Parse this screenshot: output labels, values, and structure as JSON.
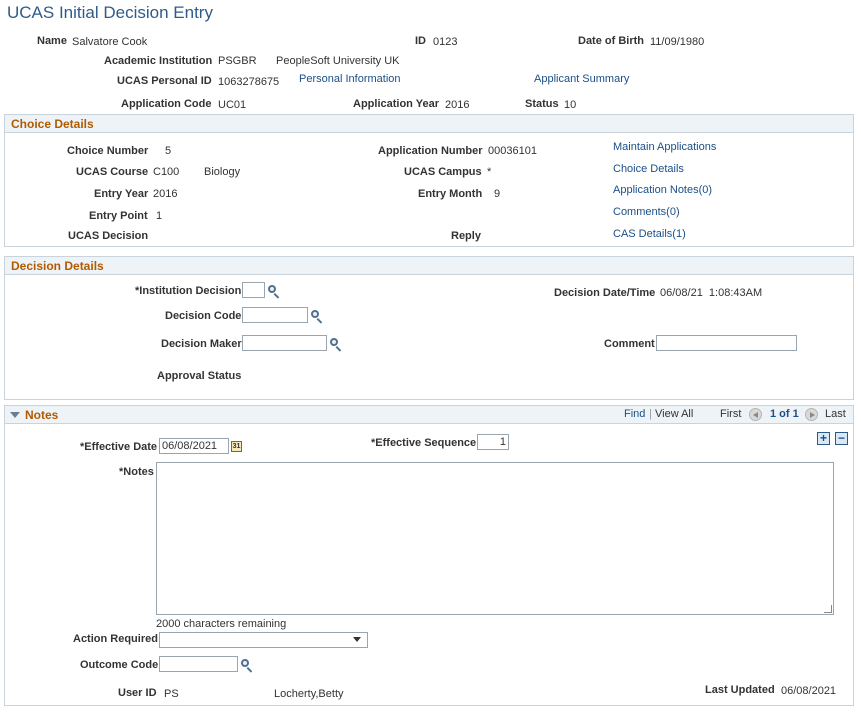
{
  "page": {
    "title": "UCAS Initial Decision Entry"
  },
  "header": {
    "name_label": "Name",
    "name_value": "Salvatore Cook",
    "id_label": "ID",
    "id_value": "0123",
    "dob_label": "Date of Birth",
    "dob_value": "11/09/1980",
    "institution_label": "Academic Institution",
    "institution_code": "PSGBR",
    "institution_name": "PeopleSoft University UK",
    "ucas_pid_label": "UCAS Personal ID",
    "ucas_pid_value": "1063278675",
    "personal_info_link": "Personal Information",
    "applicant_summary_link": "Applicant Summary",
    "app_code_label": "Application Code",
    "app_code_value": "UC01",
    "app_year_label": "Application Year",
    "app_year_value": "2016",
    "status_label": "Status",
    "status_value": "10"
  },
  "choice": {
    "section_title": "Choice Details",
    "choice_number_label": "Choice Number",
    "choice_number_value": "5",
    "app_number_label": "Application Number",
    "app_number_value": "00036101",
    "ucas_course_label": "UCAS Course",
    "ucas_course_code": "C100",
    "ucas_course_name": "Biology",
    "ucas_campus_label": "UCAS Campus",
    "ucas_campus_value": "*",
    "entry_year_label": "Entry Year",
    "entry_year_value": "2016",
    "entry_month_label": "Entry Month",
    "entry_month_value": "9",
    "entry_point_label": "Entry Point",
    "entry_point_value": "1",
    "ucas_decision_label": "UCAS Decision",
    "reply_label": "Reply",
    "links": {
      "maintain": "Maintain Applications",
      "choice_details": "Choice Details",
      "app_notes": "Application Notes(0)",
      "comments": "Comments(0)",
      "cas_details": "CAS Details(1)"
    }
  },
  "decision": {
    "section_title": "Decision Details",
    "institution_decision_label": "*Institution Decision",
    "institution_decision_value": "",
    "decision_datetime_label": "Decision Date/Time",
    "decision_datetime_value": "06/08/21  1:08:43AM",
    "decision_code_label": "Decision Code",
    "decision_code_value": "",
    "decision_maker_label": "Decision Maker",
    "decision_maker_value": "",
    "comment_label": "Comment",
    "comment_value": "",
    "approval_status_label": "Approval Status"
  },
  "notes": {
    "section_title": "Notes",
    "find_link": "Find",
    "view_all_link": "View All",
    "first_label": "First",
    "page_indicator": "1 of 1",
    "last_label": "Last",
    "effective_date_label": "*Effective Date",
    "effective_date_value": "06/08/2021",
    "effective_seq_label": "*Effective Sequence",
    "effective_seq_value": "1",
    "notes_label": "*Notes",
    "notes_value": "",
    "chars_remaining": "2000 characters remaining",
    "action_required_label": "Action Required",
    "action_required_value": "",
    "outcome_code_label": "Outcome Code",
    "outcome_code_value": "",
    "user_id_label": "User ID",
    "user_id_value": "PS",
    "user_name": "Locherty,Betty",
    "last_updated_label": "Last Updated",
    "last_updated_value": "06/08/2021",
    "add_symbol": "+",
    "remove_symbol": "−"
  }
}
